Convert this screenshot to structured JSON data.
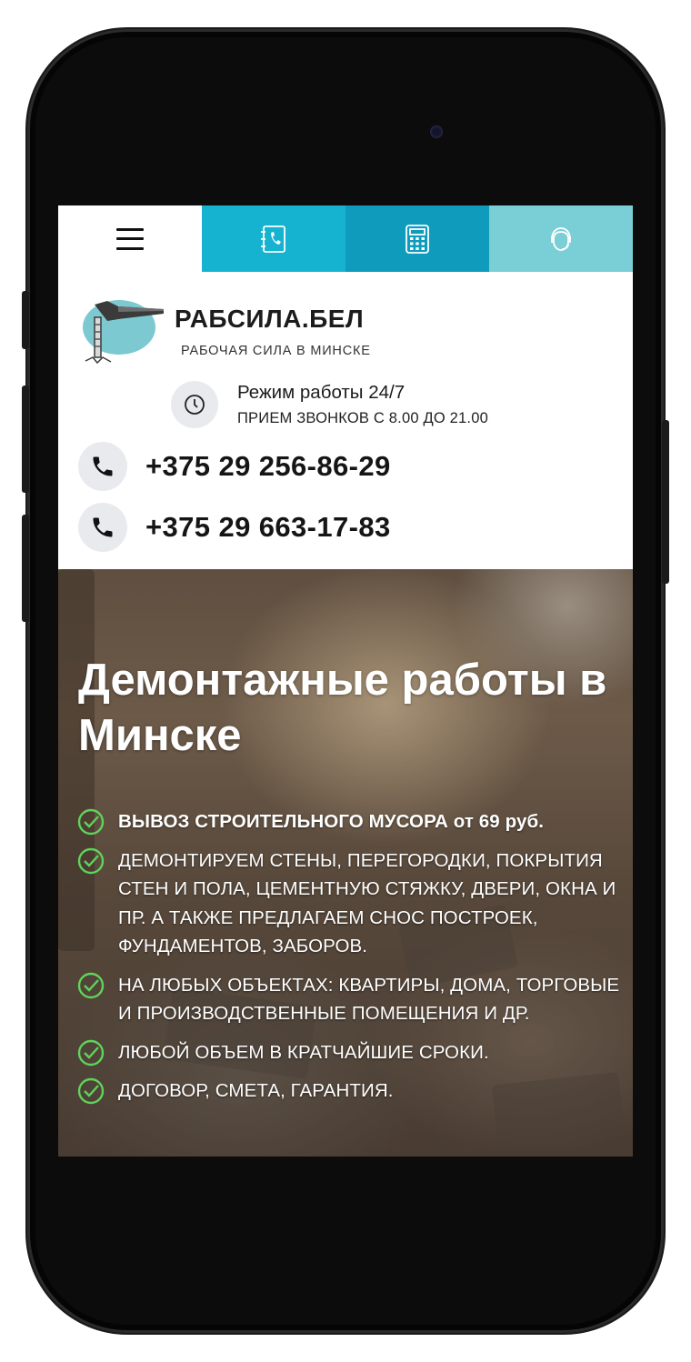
{
  "tabs": [
    {
      "name": "menu-tab",
      "icon": "hamburger-menu-icon"
    },
    {
      "name": "contacts-tab",
      "icon": "phonebook-icon",
      "color": "#16b3d1"
    },
    {
      "name": "calculator-tab",
      "icon": "calculator-icon",
      "color": "#0f9bbb"
    },
    {
      "name": "support-tab",
      "icon": "headset-icon",
      "color": "#7acfd7"
    }
  ],
  "header": {
    "brand": "РАБСИЛА.БЕЛ",
    "tagline": "РАБОЧАЯ СИЛА В МИНСКЕ",
    "hours_title": "Режим работы 24/7",
    "hours_note": "ПРИЕМ ЗВОНКОВ С 8.00 ДО 21.00",
    "phones": [
      "+375 29 256-86-29",
      "+375 29 663-17-83"
    ]
  },
  "hero": {
    "title": "Демонтажные работы в Минске",
    "features": [
      "ВЫВОЗ СТРОИТЕЛЬНОГО МУСОРА от 69 руб.",
      "ДЕМОНТИРУЕМ СТЕНЫ, ПЕРЕГОРОДКИ, ПОКРЫТИЯ СТЕН И ПОЛА, ЦЕМЕНТНУЮ СТЯЖКУ, ДВЕРИ, ОКНА И ПР. А ТАКЖЕ ПРЕДЛАГАЕМ СНОС ПОСТРОЕК, ФУНДАМЕНТОВ, ЗАБОРОВ.",
      "НА ЛЮБЫХ ОБЪЕКТАХ: КВАРТИРЫ, ДОМА, ТОРГОВЫЕ И ПРОИЗВОДСТВЕННЫЕ ПОМЕЩЕНИЯ И ДР.",
      "ЛЮБОЙ ОБЪЕМ В КРАТЧАЙШИЕ СРОКИ.",
      "ДОГОВОР, СМЕТА, ГАРАНТИЯ."
    ]
  },
  "colors": {
    "accent": "#16b3d1",
    "check": "#5fd35a"
  }
}
